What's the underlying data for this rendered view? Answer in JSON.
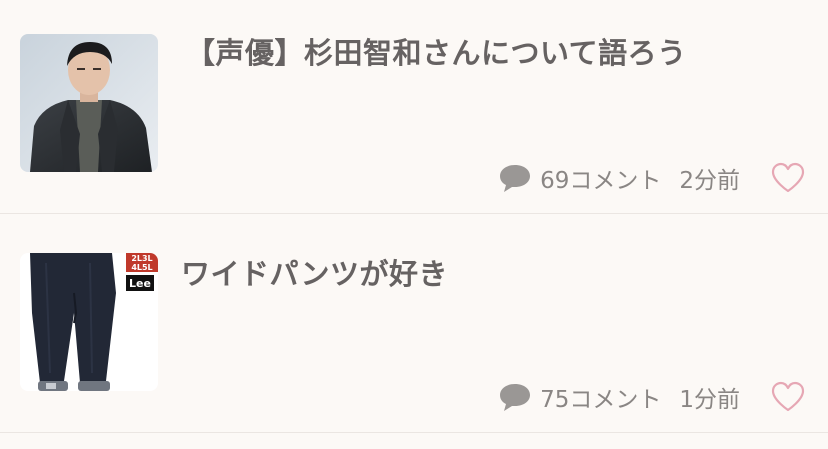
{
  "topics": [
    {
      "title": "【声優】杉田智和さんについて語ろう",
      "comment_count": "69コメント",
      "time_ago": "2分前",
      "thumbnail": "man-in-jacket-photo",
      "icons": {
        "comment": "speech-bubble-icon",
        "favorite": "heart-outline-icon"
      }
    },
    {
      "title": "ワイドパンツが好き",
      "comment_count": "75コメント",
      "time_ago": "1分前",
      "thumbnail": "wide-pants-photo",
      "thumbnail_badge_lines": [
        "2L3L",
        "4L5L"
      ],
      "thumbnail_brand": "Lee",
      "icons": {
        "comment": "speech-bubble-icon",
        "favorite": "heart-outline-icon"
      }
    }
  ],
  "colors": {
    "background": "#fcf9f6",
    "title": "#666262",
    "meta": "#8a8684",
    "icon_gray": "#9a9795",
    "heart": "#e6a7b4",
    "divider": "#ebe6e2",
    "badge_red": "#c0392b"
  }
}
